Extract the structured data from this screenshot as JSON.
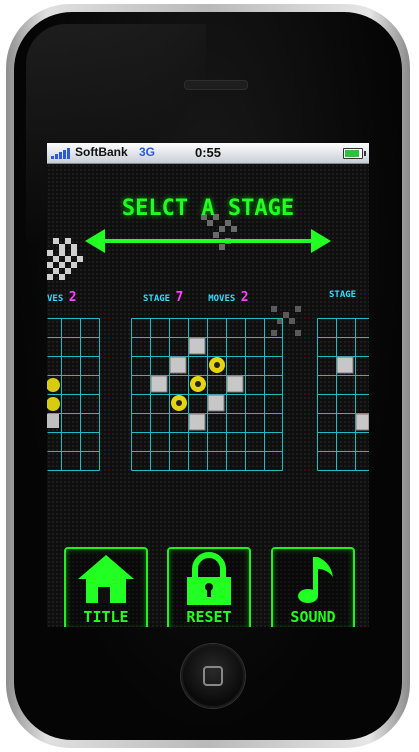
{
  "status": {
    "carrier": "SoftBank",
    "network": "3G",
    "time": "0:55"
  },
  "screen": {
    "title": "SELCT A STAGE"
  },
  "stages": {
    "left": {
      "moves_label": "VES",
      "moves_value": "2"
    },
    "center": {
      "stage_label": "STAGE",
      "stage_value": "7",
      "moves_label": "MOVES",
      "moves_value": "2"
    },
    "right": {
      "stage_label": "STAGE"
    }
  },
  "buttons": {
    "title": "TITLE",
    "reset": "RESET",
    "sound": "SOUND"
  },
  "colors": {
    "neon_green": "#22ff22",
    "grid_cyan": "#1fbcc8",
    "label_cyan": "#33ddff",
    "value_magenta": "#ff40ff"
  },
  "icons": [
    "house-icon",
    "lock-icon",
    "music-note-icon",
    "double-arrow-icon",
    "signal-icon",
    "battery-icon"
  ]
}
